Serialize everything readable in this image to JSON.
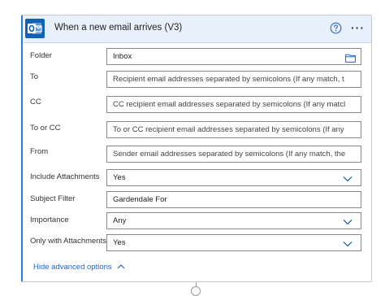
{
  "header": {
    "title": "When a new email arrives (V3)",
    "app_icon": "outlook-icon",
    "help_icon": "help-icon",
    "more_icon": "more-options-icon",
    "more_glyph": "···"
  },
  "fields": [
    {
      "label": "Folder",
      "value": "Inbox",
      "kind": "folder-picker"
    },
    {
      "label": "To",
      "value": "Recipient email addresses separated by semicolons (If any match, t",
      "kind": "placeholder"
    },
    {
      "label": "CC",
      "value": "CC recipient email addresses separated by semicolons (If any matcl",
      "kind": "placeholder"
    },
    {
      "label": "To or CC",
      "value": "To or CC recipient email addresses separated by semicolons (If any",
      "kind": "placeholder"
    },
    {
      "label": "From",
      "value": "Sender email addresses separated by semicolons (If any match, the",
      "kind": "placeholder"
    },
    {
      "label": "Include Attachments",
      "value": "Yes",
      "kind": "dropdown"
    },
    {
      "label": "Subject Filter",
      "value": "Gardendale For",
      "kind": "text"
    },
    {
      "label": "Importance",
      "value": "Any",
      "kind": "dropdown"
    },
    {
      "label": "Only with Attachments",
      "value": "Yes",
      "kind": "dropdown"
    }
  ],
  "advanced_link": {
    "label": "Hide advanced options",
    "icon": "chevron-up-icon"
  },
  "colors": {
    "accent": "#2e7bd6",
    "header_bg": "#e8f1fb",
    "outlook_blue": "#0f62b5",
    "link": "#1f66c9"
  }
}
